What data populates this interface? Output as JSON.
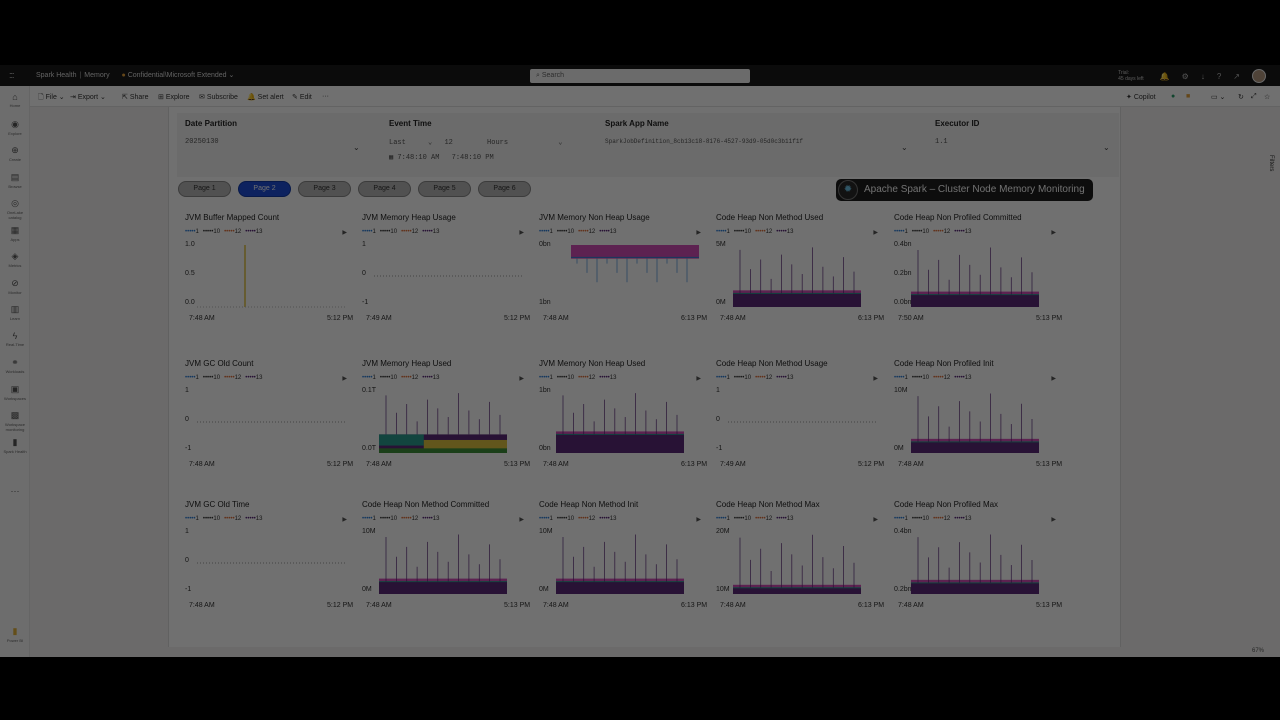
{
  "topbar": {
    "app_name": "Spark Health",
    "report_name": "Memory",
    "sensitivity": "Confidential\\Microsoft Extended",
    "search_placeholder": "Search",
    "trial_line1": "Trial:",
    "trial_line2": "45 days left"
  },
  "ribbon": {
    "file": "File",
    "export": "Export",
    "share": "Share",
    "explore": "Explore",
    "subscribe": "Subscribe",
    "set_alert": "Set alert",
    "edit": "Edit",
    "more": "···",
    "copilot": "Copilot"
  },
  "rail": {
    "items": [
      {
        "icon": "home-icon",
        "label": "Home"
      },
      {
        "icon": "fabric-icon",
        "label": "Explore"
      },
      {
        "icon": "create-icon",
        "label": "Create"
      },
      {
        "icon": "browse-icon",
        "label": "Browse"
      },
      {
        "icon": "onelake-icon",
        "label": "OneLake catalog"
      },
      {
        "icon": "apps-icon",
        "label": "Apps"
      },
      {
        "icon": "metrics-icon",
        "label": "Metrics"
      },
      {
        "icon": "monitor-icon",
        "label": "Monitor"
      },
      {
        "icon": "learn-icon",
        "label": "Learn"
      },
      {
        "icon": "realtime-icon",
        "label": "Real-Time"
      },
      {
        "icon": "workloads-icon",
        "label": "Workloads"
      },
      {
        "icon": "workspaces-icon",
        "label": "Workspaces"
      },
      {
        "icon": "workspace-icon",
        "label": "Workspace monitoring"
      },
      {
        "icon": "report-icon",
        "label": "Spark Health"
      }
    ],
    "more": "···",
    "bottom_label": "Power BI"
  },
  "filters": {
    "date_partition": {
      "title": "Date Partition",
      "value": "20250130"
    },
    "event_time": {
      "title": "Event Time",
      "mode": "Last",
      "count": "12",
      "unit": "Hours",
      "range_start": "7:48:10 AM",
      "range_end": "7:48:10 PM"
    },
    "app_name": {
      "title": "Spark App Name",
      "value": "SparkJobDefinition_8cb13c18-8176-4527-93d9-05d0c3b11f1f"
    },
    "executor_id": {
      "title": "Executor ID",
      "value": "1.1"
    }
  },
  "pages": [
    "Page 1",
    "Page 2",
    "Page 3",
    "Page 4",
    "Page 5",
    "Page 6"
  ],
  "active_page": 1,
  "report_title": "Apache Spark – Cluster Node Memory Monitoring",
  "legend": [
    "1",
    "10",
    "12",
    "13"
  ],
  "colors": {
    "accent": "#1f4fd8",
    "pink": "#d44fb9",
    "purple": "#5b2b7a",
    "blue": "#2f7fd8",
    "teal": "#2a9d8f",
    "green": "#3f8f3a",
    "yellow": "#e0c341"
  },
  "charts": [
    {
      "title": "JVM Buffer Mapped Count",
      "y_ticks": [
        "1.0",
        "0.5",
        "0.0"
      ],
      "x_start": "7:48 AM",
      "x_end": "5:12 PM",
      "kind": "spike",
      "level": 0
    },
    {
      "title": "JVM Memory Heap Usage",
      "y_ticks": [
        "1",
        "0",
        "-1"
      ],
      "x_start": "7:49 AM",
      "x_end": "5:12 PM",
      "kind": "flat",
      "level": 0
    },
    {
      "title": "JVM Memory Non Heap Usage",
      "y_ticks": [
        "0bn",
        "1bn"
      ],
      "x_start": "7:48 AM",
      "x_end": "6:13 PM",
      "kind": "topband",
      "level": 0.85
    },
    {
      "title": "Code Heap Non Method Used",
      "y_ticks": [
        "5M",
        "0M"
      ],
      "x_start": "7:48 AM",
      "x_end": "6:13 PM",
      "kind": "base",
      "level": 0.22
    },
    {
      "title": "Code Heap Non Profiled Committed",
      "y_ticks": [
        "0.4bn",
        "0.2bn",
        "0.0bn"
      ],
      "x_start": "7:50 AM",
      "x_end": "5:13 PM",
      "kind": "base",
      "level": 0.2
    },
    {
      "title": "JVM GC Old Count",
      "y_ticks": [
        "1",
        "0",
        "-1"
      ],
      "x_start": "7:48 AM",
      "x_end": "5:12 PM",
      "kind": "flat",
      "level": 0
    },
    {
      "title": "JVM Memory Heap Used",
      "y_ticks": [
        "0.1T",
        "0.0T"
      ],
      "x_start": "7:48 AM",
      "x_end": "5:13 PM",
      "kind": "mixed",
      "level": 0.3
    },
    {
      "title": "JVM Memory Non Heap Used",
      "y_ticks": [
        "1bn",
        "0bn"
      ],
      "x_start": "7:48 AM",
      "x_end": "6:13 PM",
      "kind": "base",
      "level": 0.3
    },
    {
      "title": "Code Heap Non Method Usage",
      "y_ticks": [
        "1",
        "0",
        "-1"
      ],
      "x_start": "7:49 AM",
      "x_end": "5:12 PM",
      "kind": "flat",
      "level": 0
    },
    {
      "title": "Code Heap Non Profiled Init",
      "y_ticks": [
        "10M",
        "0M"
      ],
      "x_start": "7:48 AM",
      "x_end": "5:13 PM",
      "kind": "base",
      "level": 0.18
    },
    {
      "title": "JVM GC Old Time",
      "y_ticks": [
        "1",
        "0",
        "-1"
      ],
      "x_start": "7:48 AM",
      "x_end": "5:12 PM",
      "kind": "flat",
      "level": 0
    },
    {
      "title": "Code Heap Non Method Committed",
      "y_ticks": [
        "10M",
        "0M"
      ],
      "x_start": "7:48 AM",
      "x_end": "5:13 PM",
      "kind": "base",
      "level": 0.2
    },
    {
      "title": "Code Heap Non Method Init",
      "y_ticks": [
        "10M",
        "0M"
      ],
      "x_start": "7:48 AM",
      "x_end": "6:13 PM",
      "kind": "base",
      "level": 0.2
    },
    {
      "title": "Code Heap Non Method Max",
      "y_ticks": [
        "20M",
        "10M"
      ],
      "x_start": "7:48 AM",
      "x_end": "6:13 PM",
      "kind": "base",
      "level": 0.1
    },
    {
      "title": "Code Heap Non Profiled Max",
      "y_ticks": [
        "0.4bn",
        "0.2bn"
      ],
      "x_start": "7:48 AM",
      "x_end": "5:13 PM",
      "kind": "base",
      "level": 0.18
    }
  ],
  "statusbar": {
    "zoom": "67%"
  }
}
